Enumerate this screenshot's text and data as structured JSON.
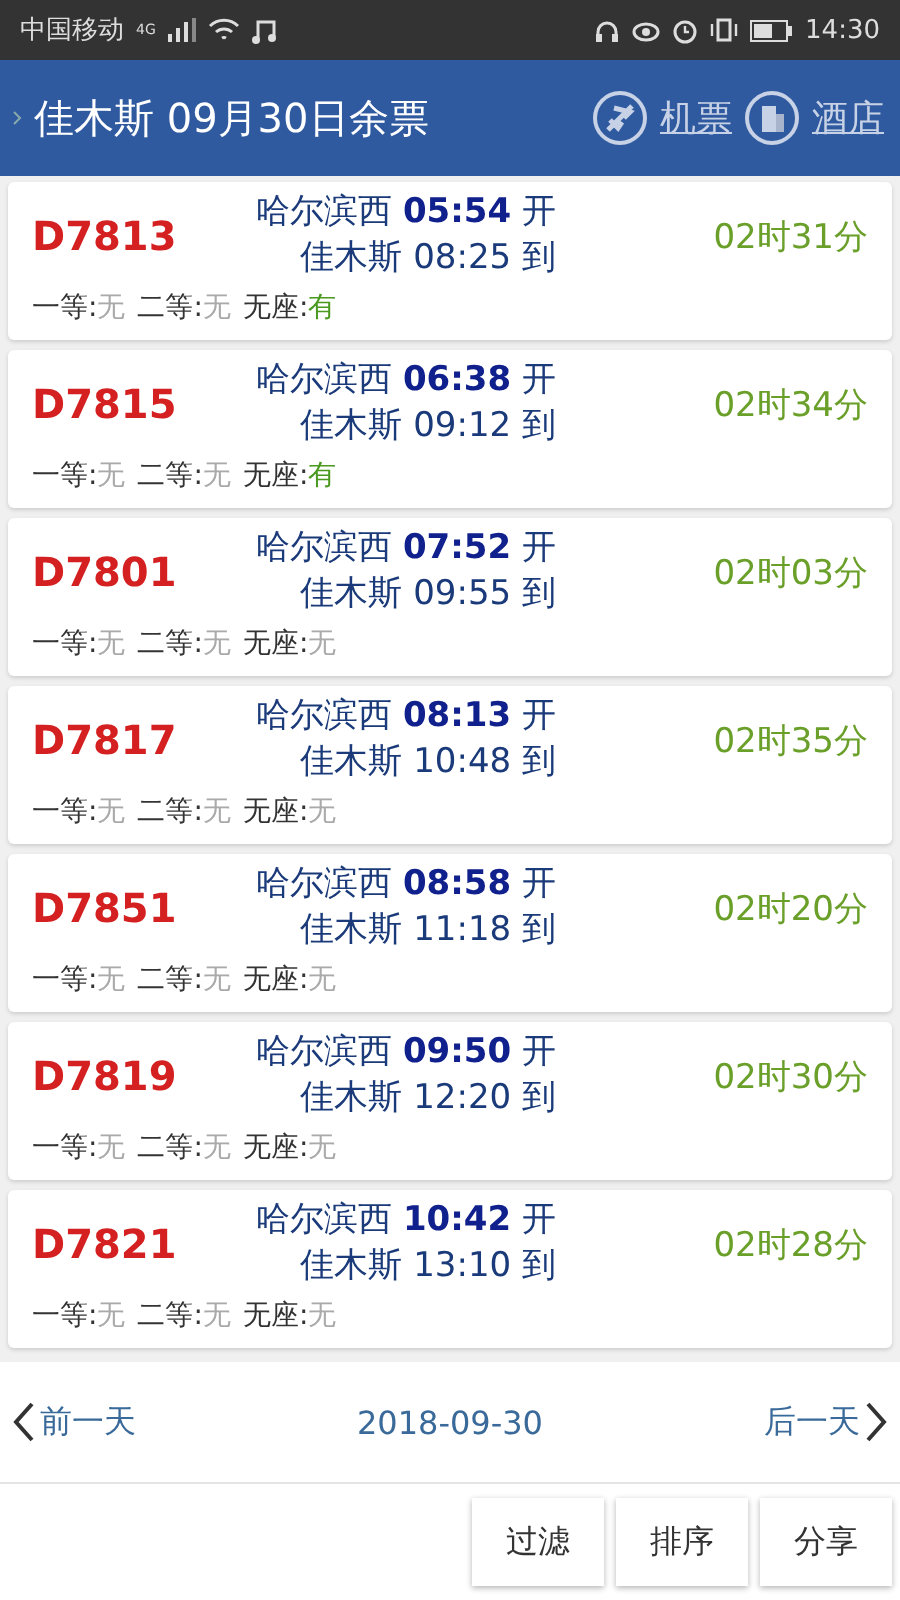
{
  "status_bar": {
    "carrier": "中国移动",
    "network": "4G",
    "time": "14:30"
  },
  "header": {
    "title": "佳木斯 09月30日余票",
    "links": [
      "机票",
      "酒店"
    ]
  },
  "trains": [
    {
      "number": "D7813",
      "from": "哈尔滨西",
      "depart": "05:54",
      "depart_label": "开",
      "to": "佳木斯",
      "arrive": "08:25",
      "arrive_label": "到",
      "duration": "02时31分",
      "seats": [
        {
          "label": "一等:",
          "value": "无",
          "available": false
        },
        {
          "label": "二等:",
          "value": "无",
          "available": false
        },
        {
          "label": "无座:",
          "value": "有",
          "available": true
        }
      ]
    },
    {
      "number": "D7815",
      "from": "哈尔滨西",
      "depart": "06:38",
      "depart_label": "开",
      "to": "佳木斯",
      "arrive": "09:12",
      "arrive_label": "到",
      "duration": "02时34分",
      "seats": [
        {
          "label": "一等:",
          "value": "无",
          "available": false
        },
        {
          "label": "二等:",
          "value": "无",
          "available": false
        },
        {
          "label": "无座:",
          "value": "有",
          "available": true
        }
      ]
    },
    {
      "number": "D7801",
      "from": "哈尔滨西",
      "depart": "07:52",
      "depart_label": "开",
      "to": "佳木斯",
      "arrive": "09:55",
      "arrive_label": "到",
      "duration": "02时03分",
      "seats": [
        {
          "label": "一等:",
          "value": "无",
          "available": false
        },
        {
          "label": "二等:",
          "value": "无",
          "available": false
        },
        {
          "label": "无座:",
          "value": "无",
          "available": false
        }
      ]
    },
    {
      "number": "D7817",
      "from": "哈尔滨西",
      "depart": "08:13",
      "depart_label": "开",
      "to": "佳木斯",
      "arrive": "10:48",
      "arrive_label": "到",
      "duration": "02时35分",
      "seats": [
        {
          "label": "一等:",
          "value": "无",
          "available": false
        },
        {
          "label": "二等:",
          "value": "无",
          "available": false
        },
        {
          "label": "无座:",
          "value": "无",
          "available": false
        }
      ]
    },
    {
      "number": "D7851",
      "from": "哈尔滨西",
      "depart": "08:58",
      "depart_label": "开",
      "to": "佳木斯",
      "arrive": "11:18",
      "arrive_label": "到",
      "duration": "02时20分",
      "seats": [
        {
          "label": "一等:",
          "value": "无",
          "available": false
        },
        {
          "label": "二等:",
          "value": "无",
          "available": false
        },
        {
          "label": "无座:",
          "value": "无",
          "available": false
        }
      ]
    },
    {
      "number": "D7819",
      "from": "哈尔滨西",
      "depart": "09:50",
      "depart_label": "开",
      "to": "佳木斯",
      "arrive": "12:20",
      "arrive_label": "到",
      "duration": "02时30分",
      "seats": [
        {
          "label": "一等:",
          "value": "无",
          "available": false
        },
        {
          "label": "二等:",
          "value": "无",
          "available": false
        },
        {
          "label": "无座:",
          "value": "无",
          "available": false
        }
      ]
    },
    {
      "number": "D7821",
      "from": "哈尔滨西",
      "depart": "10:42",
      "depart_label": "开",
      "to": "佳木斯",
      "arrive": "13:10",
      "arrive_label": "到",
      "duration": "02时28分",
      "seats": [
        {
          "label": "一等:",
          "value": "无",
          "available": false
        },
        {
          "label": "二等:",
          "value": "无",
          "available": false
        },
        {
          "label": "无座:",
          "value": "无",
          "available": false
        }
      ]
    }
  ],
  "date_nav": {
    "prev": "前一天",
    "date": "2018-09-30",
    "next": "后一天"
  },
  "buttons": [
    "过滤",
    "排序",
    "分享"
  ]
}
